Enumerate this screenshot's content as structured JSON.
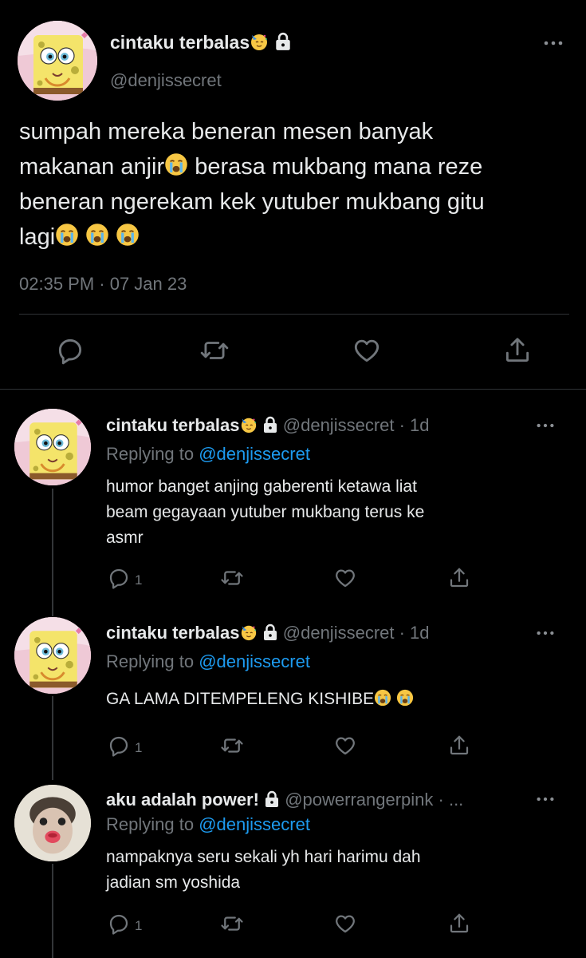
{
  "main_tweet": {
    "display_name": "cintaku terbalas",
    "handle": "@denjissecret",
    "text_lines": [
      "sumpah mereka beneran mesen banyak",
      "makanan anjir",
      " berasa mukbang mana reze",
      "beneran ngerekam kek yutuber mukbang gitu",
      "lagi"
    ],
    "timestamp": "02:35 PM · 07 Jan 23"
  },
  "replies": [
    {
      "display_name": "cintaku terbalas",
      "handle": "@denjissecret · 1d",
      "replying_prefix": "Replying to",
      "replying_to": "@denjissecret",
      "text_lines": [
        "humor banget anjing gaberenti ketawa liat",
        "beam gegayaan yutuber mukbang terus ke",
        "asmr"
      ],
      "reply_count": "1"
    },
    {
      "display_name": "cintaku terbalas",
      "handle": "@denjissecret · 1d",
      "replying_prefix": "Replying to",
      "replying_to": "@denjissecret",
      "text_lines": [
        "GA LAMA DITEMPELENG KISHIBE"
      ],
      "reply_count": "1"
    },
    {
      "display_name": "aku adalah power!",
      "handle": "@powerrangerpink · ...",
      "replying_prefix": "Replying to",
      "replying_to": "@denjissecret",
      "text_lines": [
        "nampaknya seru sekali yh hari harimu dah",
        "jadian sm yoshida"
      ],
      "reply_count": "1"
    }
  ],
  "icons": [
    "more-icon",
    "lock-icon",
    "emoji-icon",
    "reply-icon",
    "retweet-icon",
    "like-icon",
    "share-icon"
  ],
  "colors": {
    "background": "#000000",
    "text": "#e7e9ea",
    "muted": "#71767b",
    "link": "#1d9bf0",
    "divider": "#2f3336"
  }
}
